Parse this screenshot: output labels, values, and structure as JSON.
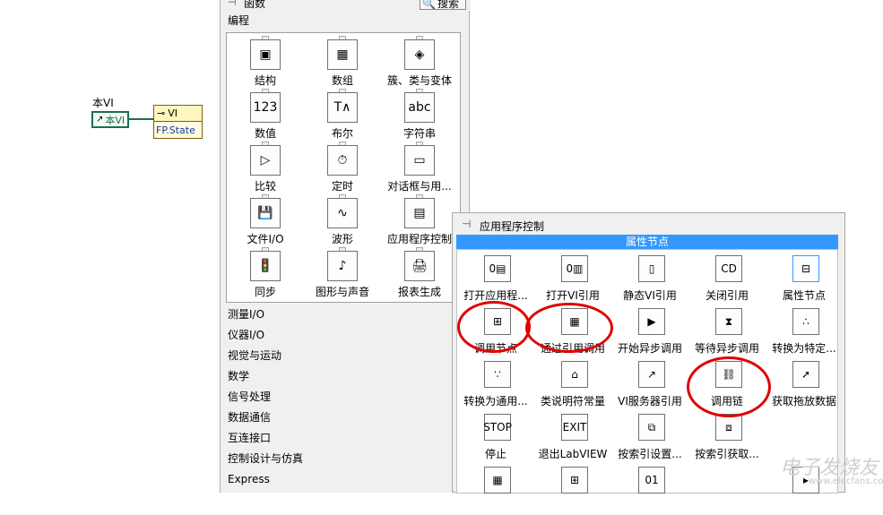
{
  "diagram": {
    "vi_label": "本VI",
    "vi_constant": "本VI",
    "prop_node_top": "VI",
    "prop_node_property": "FP.State"
  },
  "palette": {
    "title": "函数",
    "search_label": "搜索",
    "category_open": "编程",
    "items": [
      {
        "label": "结构",
        "icon": "structure-icon",
        "glyph": "▣"
      },
      {
        "label": "数组",
        "icon": "array-icon",
        "glyph": "▦"
      },
      {
        "label": "簇、类与变体",
        "icon": "cluster-icon",
        "glyph": "◈"
      },
      {
        "label": "数值",
        "icon": "numeric-icon",
        "glyph": "123"
      },
      {
        "label": "布尔",
        "icon": "boolean-icon",
        "glyph": "T∧"
      },
      {
        "label": "字符串",
        "icon": "string-icon",
        "glyph": "abc"
      },
      {
        "label": "比较",
        "icon": "comparison-icon",
        "glyph": "▷"
      },
      {
        "label": "定时",
        "icon": "timing-icon",
        "glyph": "⏱"
      },
      {
        "label": "对话框与用...",
        "icon": "dialog-icon",
        "glyph": "▭"
      },
      {
        "label": "文件I/O",
        "icon": "file-io-icon",
        "glyph": "💾"
      },
      {
        "label": "波形",
        "icon": "waveform-icon",
        "glyph": "∿"
      },
      {
        "label": "应用程序控制",
        "icon": "app-control-icon",
        "glyph": "▤"
      },
      {
        "label": "同步",
        "icon": "sync-icon",
        "glyph": "🚦"
      },
      {
        "label": "图形与声音",
        "icon": "graphics-sound-icon",
        "glyph": "♪"
      },
      {
        "label": "报表生成",
        "icon": "report-icon",
        "glyph": "🖨"
      }
    ],
    "categories": [
      "测量I/O",
      "仪器I/O",
      "视觉与运动",
      "数学",
      "信号处理",
      "数据通信",
      "互连接口",
      "控制设计与仿真",
      "Express"
    ]
  },
  "subpalette": {
    "title": "应用程序控制",
    "highlight": "属性节点",
    "items": [
      {
        "label": "打开应用程...",
        "icon": "open-app-ref-icon",
        "glyph": "0▤"
      },
      {
        "label": "打开VI引用",
        "icon": "open-vi-ref-icon",
        "glyph": "0▥"
      },
      {
        "label": "静态VI引用",
        "icon": "static-vi-ref-icon",
        "glyph": "▯"
      },
      {
        "label": "关闭引用",
        "icon": "close-ref-icon",
        "glyph": "CD"
      },
      {
        "label": "属性节点",
        "icon": "property-node-icon",
        "glyph": "⊟"
      },
      {
        "label": "调用节点",
        "icon": "invoke-node-icon",
        "glyph": "⊞"
      },
      {
        "label": "通过引用调用",
        "icon": "call-by-ref-icon",
        "glyph": "▦"
      },
      {
        "label": "开始异步调用",
        "icon": "start-async-icon",
        "glyph": "▶"
      },
      {
        "label": "等待异步调用",
        "icon": "wait-async-icon",
        "glyph": "⧗"
      },
      {
        "label": "转换为特定...",
        "icon": "to-specific-icon",
        "glyph": "∴"
      },
      {
        "label": "转换为通用...",
        "icon": "to-generic-icon",
        "glyph": "∵"
      },
      {
        "label": "类说明符常量",
        "icon": "class-spec-icon",
        "glyph": "⌂"
      },
      {
        "label": "VI服务器引用",
        "icon": "vi-server-ref-icon",
        "glyph": "↗"
      },
      {
        "label": "调用链",
        "icon": "call-chain-icon",
        "glyph": "⛓"
      },
      {
        "label": "获取拖放数据",
        "icon": "drag-drop-icon",
        "glyph": "➚"
      },
      {
        "label": "停止",
        "icon": "stop-icon",
        "glyph": "STOP"
      },
      {
        "label": "退出LabVIEW",
        "icon": "exit-icon",
        "glyph": "EXIT"
      },
      {
        "label": "按索引设置...",
        "icon": "set-by-index-icon",
        "glyph": "⧉"
      },
      {
        "label": "按索引获取...",
        "icon": "get-by-index-icon",
        "glyph": "⧈"
      }
    ],
    "bottom_row": [
      {
        "icon": "menu-icon",
        "glyph": "▦"
      },
      {
        "icon": "bus-icon",
        "glyph": "⊞"
      },
      {
        "icon": "binary-icon",
        "glyph": "01"
      },
      {
        "icon": "folder-icon",
        "glyph": "▸"
      }
    ]
  },
  "watermark": {
    "text": "电子发烧友",
    "sub": "www.elecfans.com"
  },
  "colors": {
    "highlight": "#3399ff",
    "annotation": "#e00000"
  }
}
